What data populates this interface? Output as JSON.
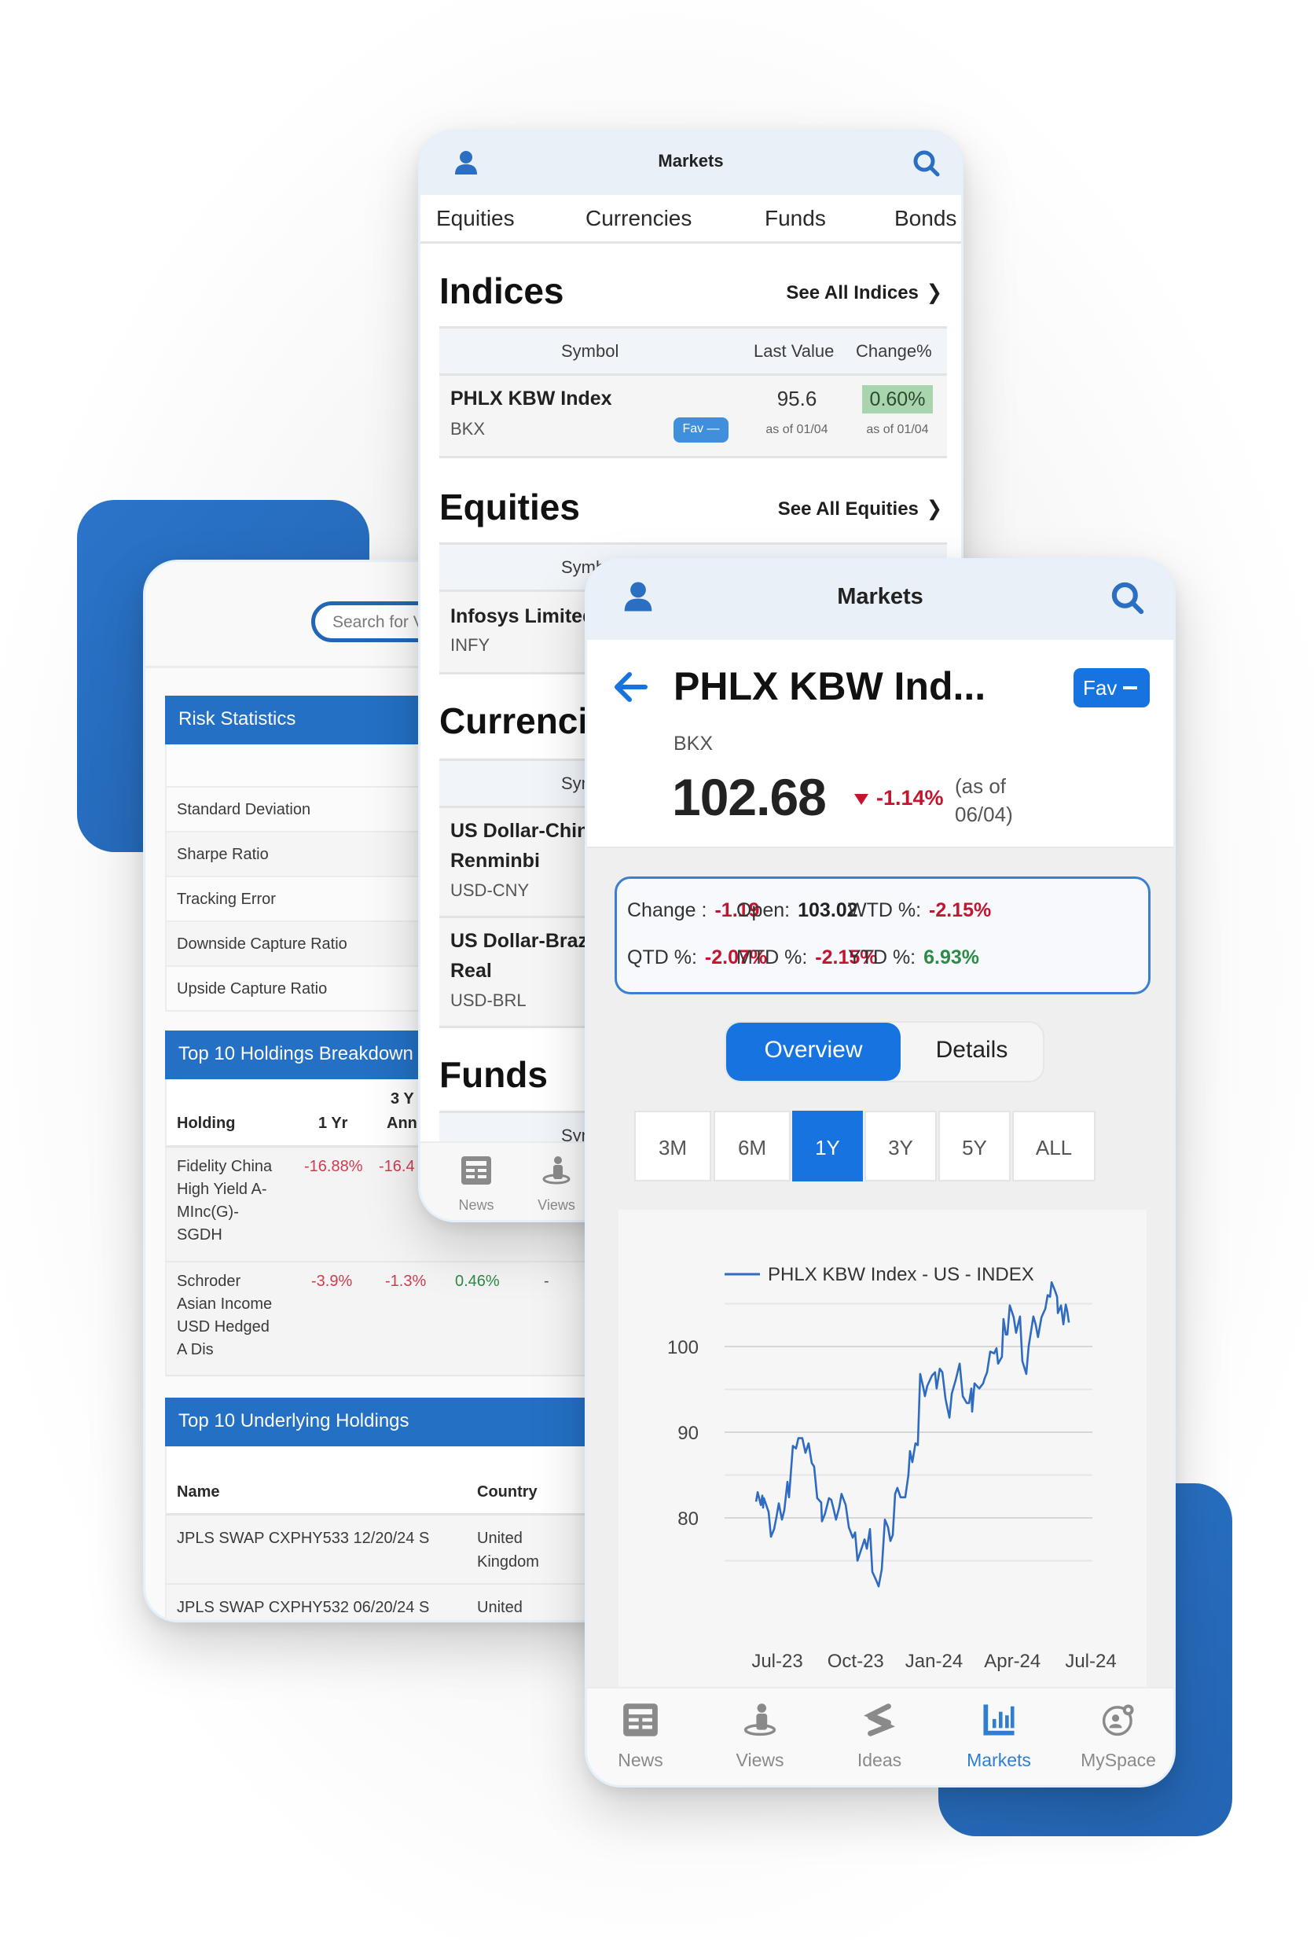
{
  "colors": {
    "brand_blue": "#2470c4",
    "accent_blue": "#1673e0",
    "negative": "#c4152f",
    "positive": "#2e8b46",
    "header_bg": "#e9f0f8"
  },
  "left_phone": {
    "search_placeholder": "Search for V",
    "risk_statistics": {
      "title": "Risk Statistics",
      "rows": [
        "Standard Deviation",
        "Sharpe Ratio",
        "Tracking Error",
        "Downside Capture Ratio",
        "Upside Capture Ratio"
      ]
    },
    "top_holdings": {
      "title": "Top 10 Holdings Breakdown",
      "columns": [
        "Holding",
        "1 Yr",
        "3 Y",
        "Ann"
      ],
      "rows": [
        {
          "name": "Fidelity China High Yield A-MInc(G)-SGDH",
          "name_lines": [
            "Fidelity China",
            "High Yield A-",
            "MInc(G)-",
            "SGDH"
          ],
          "one_yr": "-16.88%",
          "three_yr": "-16.4"
        },
        {
          "name": "Schroder Asian Income USD Hedged A Dis",
          "name_lines": [
            "Schroder",
            "Asian Income",
            "USD Hedged",
            "A Dis"
          ],
          "one_yr": "-3.9%",
          "three_yr": "-1.3%",
          "col4": "0.46%",
          "col5": "-"
        }
      ]
    },
    "underlying_holdings": {
      "title": "Top 10 Underlying Holdings",
      "columns": [
        "Name",
        "Country"
      ],
      "rows": [
        {
          "name": "JPLS SWAP CXPHY533 12/20/24 S",
          "country_lines": [
            "United",
            "Kingdom"
          ]
        },
        {
          "name": "JPLS SWAP CXPHY532 06/20/24 S",
          "country_lines": [
            "United"
          ]
        }
      ]
    }
  },
  "middle_phone": {
    "header_title": "Markets",
    "tabs": [
      "Equities",
      "Currencies",
      "Funds",
      "Bonds"
    ],
    "table_columns": [
      "Symbol",
      "Last Value",
      "Change%"
    ],
    "indices": {
      "title": "Indices",
      "see_all": "See All Indices",
      "rows": [
        {
          "name": "PHLX KBW Index",
          "symbol": "BKX",
          "fav": "Fav",
          "last_value": "95.6",
          "last_asof": "as of 01/04",
          "change": "0.60%",
          "change_asof": "as of 01/04"
        }
      ]
    },
    "equities": {
      "title": "Equities",
      "see_all": "See All Equities",
      "col_partial": "Symb",
      "rows": [
        {
          "name": "Infosys Limited",
          "symbol": "INFY"
        }
      ]
    },
    "currencies": {
      "title": "Currencies",
      "col_partial": "Sym",
      "rows": [
        {
          "name_line1": "US Dollar-Chinese Yuan",
          "name_line2": "Renminbi",
          "symbol": "USD-CNY"
        },
        {
          "name_line1": "US Dollar-Brazilian",
          "name_line2": "Real",
          "symbol": "USD-BRL"
        }
      ]
    },
    "funds": {
      "title": "Funds",
      "col_partial": "Sym"
    },
    "nav": [
      {
        "label": "News",
        "icon": "news-icon"
      },
      {
        "label": "Views",
        "icon": "views-icon"
      }
    ]
  },
  "front_phone": {
    "header_title": "Markets",
    "title": "PHLX KBW Ind...",
    "fav_label": "Fav",
    "symbol": "BKX",
    "price": "102.68",
    "change_pct": "-1.14%",
    "as_of_line1": "(as of",
    "as_of_line2": "06/04)",
    "stats": [
      {
        "label": "Change :",
        "value": "-1.19",
        "tone": "red"
      },
      {
        "label": "Open:",
        "value": "103.02",
        "tone": "dark"
      },
      {
        "label": "WTD %:",
        "value": "-2.15%",
        "tone": "red"
      },
      {
        "label": "QTD %:",
        "value": "-2.07%",
        "tone": "red"
      },
      {
        "label": "MTD %:",
        "value": "-2.15%",
        "tone": "red"
      },
      {
        "label": "YTD %:",
        "value": "6.93%",
        "tone": "green"
      }
    ],
    "segments": [
      {
        "label": "Overview",
        "active": true
      },
      {
        "label": "Details",
        "active": false
      }
    ],
    "ranges": [
      {
        "label": "3M",
        "active": false
      },
      {
        "label": "6M",
        "active": false
      },
      {
        "label": "1Y",
        "active": true
      },
      {
        "label": "3Y",
        "active": false
      },
      {
        "label": "5Y",
        "active": false
      },
      {
        "label": "ALL",
        "active": false
      }
    ],
    "nav": [
      {
        "label": "News",
        "icon": "news-icon",
        "active": false
      },
      {
        "label": "Views",
        "icon": "views-icon",
        "active": false
      },
      {
        "label": "Ideas",
        "icon": "ideas-icon",
        "active": false
      },
      {
        "label": "Markets",
        "icon": "markets-icon",
        "active": true
      },
      {
        "label": "MySpace",
        "icon": "myspace-icon",
        "active": false
      }
    ]
  },
  "chart_data": {
    "type": "line",
    "title": "",
    "legend": [
      "PHLX KBW Index - US - INDEX"
    ],
    "legend_position": "top-left",
    "xlabel": "",
    "ylabel": "",
    "x_ticks": [
      "Jul-23",
      "Oct-23",
      "Jan-24",
      "Apr-24",
      "Jul-24"
    ],
    "x_tick_months": [
      0,
      3,
      6,
      9,
      12
    ],
    "x_unit": "months since Jul-23",
    "xlim": [
      -0.9,
      12
    ],
    "y_ticks": [
      80,
      90,
      100
    ],
    "y_gridlines": [
      75,
      80,
      85,
      90,
      95,
      100,
      105
    ],
    "ylim": [
      71,
      108
    ],
    "grid": true,
    "series": [
      {
        "name": "PHLX KBW Index - US - INDEX",
        "color": "#2f6bc0",
        "points": [
          [
            -0.81,
            81.9
          ],
          [
            -0.75,
            83.0
          ],
          [
            -0.63,
            81.5
          ],
          [
            -0.57,
            82.6
          ],
          [
            -0.54,
            81.2
          ],
          [
            -0.51,
            82.3
          ],
          [
            -0.33,
            80.7
          ],
          [
            -0.24,
            77.8
          ],
          [
            -0.12,
            78.7
          ],
          [
            -0.03,
            80.1
          ],
          [
            0.06,
            81.7
          ],
          [
            0.18,
            79.8
          ],
          [
            0.27,
            80.9
          ],
          [
            0.39,
            84.2
          ],
          [
            0.45,
            82.4
          ],
          [
            0.6,
            88.4
          ],
          [
            0.72,
            88.1
          ],
          [
            0.81,
            89.3
          ],
          [
            0.96,
            89.3
          ],
          [
            1.08,
            87.6
          ],
          [
            1.2,
            88.7
          ],
          [
            1.32,
            86.4
          ],
          [
            1.41,
            86.0
          ],
          [
            1.53,
            82.3
          ],
          [
            1.68,
            81.8
          ],
          [
            1.71,
            79.6
          ],
          [
            1.83,
            80.5
          ],
          [
            1.98,
            82.3
          ],
          [
            2.07,
            82.1
          ],
          [
            2.16,
            81.0
          ],
          [
            2.25,
            79.8
          ],
          [
            2.37,
            81.2
          ],
          [
            2.46,
            82.8
          ],
          [
            2.62,
            81.5
          ],
          [
            2.74,
            78.9
          ],
          [
            2.89,
            77.7
          ],
          [
            2.98,
            78.3
          ],
          [
            3.07,
            75.0
          ],
          [
            3.19,
            76.1
          ],
          [
            3.34,
            77.5
          ],
          [
            3.43,
            76.4
          ],
          [
            3.55,
            78.7
          ],
          [
            3.64,
            73.7
          ],
          [
            3.79,
            72.7
          ],
          [
            3.88,
            72.0
          ],
          [
            4.0,
            74.0
          ],
          [
            4.12,
            79.8
          ],
          [
            4.24,
            78.9
          ],
          [
            4.33,
            77.3
          ],
          [
            4.42,
            78.0
          ],
          [
            4.51,
            82.8
          ],
          [
            4.6,
            83.5
          ],
          [
            4.72,
            82.4
          ],
          [
            4.9,
            82.4
          ],
          [
            5.02,
            85.0
          ],
          [
            5.08,
            87.8
          ],
          [
            5.17,
            86.5
          ],
          [
            5.29,
            88.7
          ],
          [
            5.38,
            88.5
          ],
          [
            5.47,
            96.8
          ],
          [
            5.59,
            95.2
          ],
          [
            5.65,
            94.2
          ],
          [
            5.74,
            95.4
          ],
          [
            5.92,
            96.6
          ],
          [
            6.04,
            97.0
          ],
          [
            6.1,
            95.1
          ],
          [
            6.22,
            97.4
          ],
          [
            6.32,
            97.0
          ],
          [
            6.44,
            93.9
          ],
          [
            6.59,
            91.7
          ],
          [
            6.68,
            94.5
          ],
          [
            6.83,
            96.1
          ],
          [
            6.98,
            98.0
          ],
          [
            7.1,
            94.2
          ],
          [
            7.25,
            93.4
          ],
          [
            7.34,
            93.4
          ],
          [
            7.43,
            95.1
          ],
          [
            7.46,
            92.4
          ],
          [
            7.55,
            95.7
          ],
          [
            7.73,
            95.1
          ],
          [
            7.88,
            95.7
          ],
          [
            7.94,
            96.3
          ],
          [
            8.03,
            97.0
          ],
          [
            8.15,
            99.4
          ],
          [
            8.3,
            99.2
          ],
          [
            8.39,
            99.8
          ],
          [
            8.45,
            98.0
          ],
          [
            8.6,
            98.8
          ],
          [
            8.66,
            103.2
          ],
          [
            8.75,
            101.4
          ],
          [
            8.81,
            101.4
          ],
          [
            8.9,
            104.8
          ],
          [
            9.05,
            103.4
          ],
          [
            9.14,
            101.6
          ],
          [
            9.29,
            103.5
          ],
          [
            9.38,
            98.3
          ],
          [
            9.53,
            96.8
          ],
          [
            9.62,
            100.0
          ],
          [
            9.8,
            103.5
          ],
          [
            9.89,
            102.6
          ],
          [
            9.98,
            101.1
          ],
          [
            10.11,
            103.4
          ],
          [
            10.26,
            104.4
          ],
          [
            10.35,
            106.0
          ],
          [
            10.44,
            105.8
          ],
          [
            10.5,
            107.5
          ],
          [
            10.62,
            106.6
          ],
          [
            10.71,
            105.8
          ],
          [
            10.74,
            103.9
          ],
          [
            10.86,
            104.8
          ],
          [
            10.95,
            102.6
          ],
          [
            11.04,
            104.9
          ],
          [
            11.1,
            104.1
          ],
          [
            11.16,
            102.8
          ]
        ]
      }
    ]
  }
}
